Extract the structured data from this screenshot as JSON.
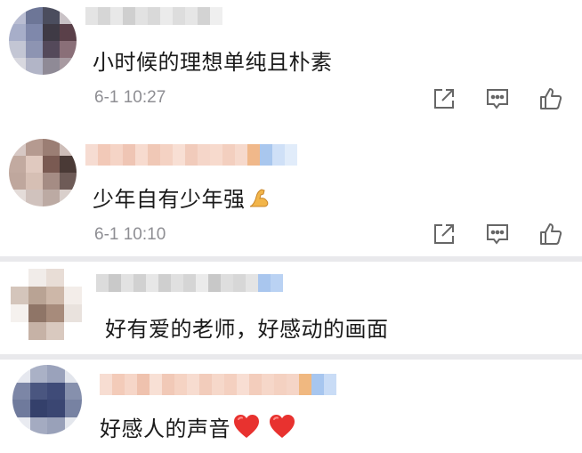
{
  "comments": [
    {
      "text": "小时候的理想单纯且朴素",
      "time": "6-1 10:27",
      "emoji": ""
    },
    {
      "text": "少年自有少年强",
      "time": "6-1 10:10",
      "emoji": "flexed-biceps-icon"
    },
    {
      "text": "好有爱的老师，好感动的画面",
      "time": "",
      "emoji": ""
    },
    {
      "text": "好感人的声音",
      "time": "",
      "emoji": "red-heart-icon x2"
    }
  ],
  "actions": {
    "share_icon": "share-icon",
    "comment_icon": "comment-icon",
    "like_icon": "thumbs-up-icon"
  },
  "colors": {
    "text": "#1a1a1a",
    "time": "#8e8e93",
    "icon": "#666666",
    "divider": "#e9e9ec",
    "heart": "#e8322f"
  }
}
